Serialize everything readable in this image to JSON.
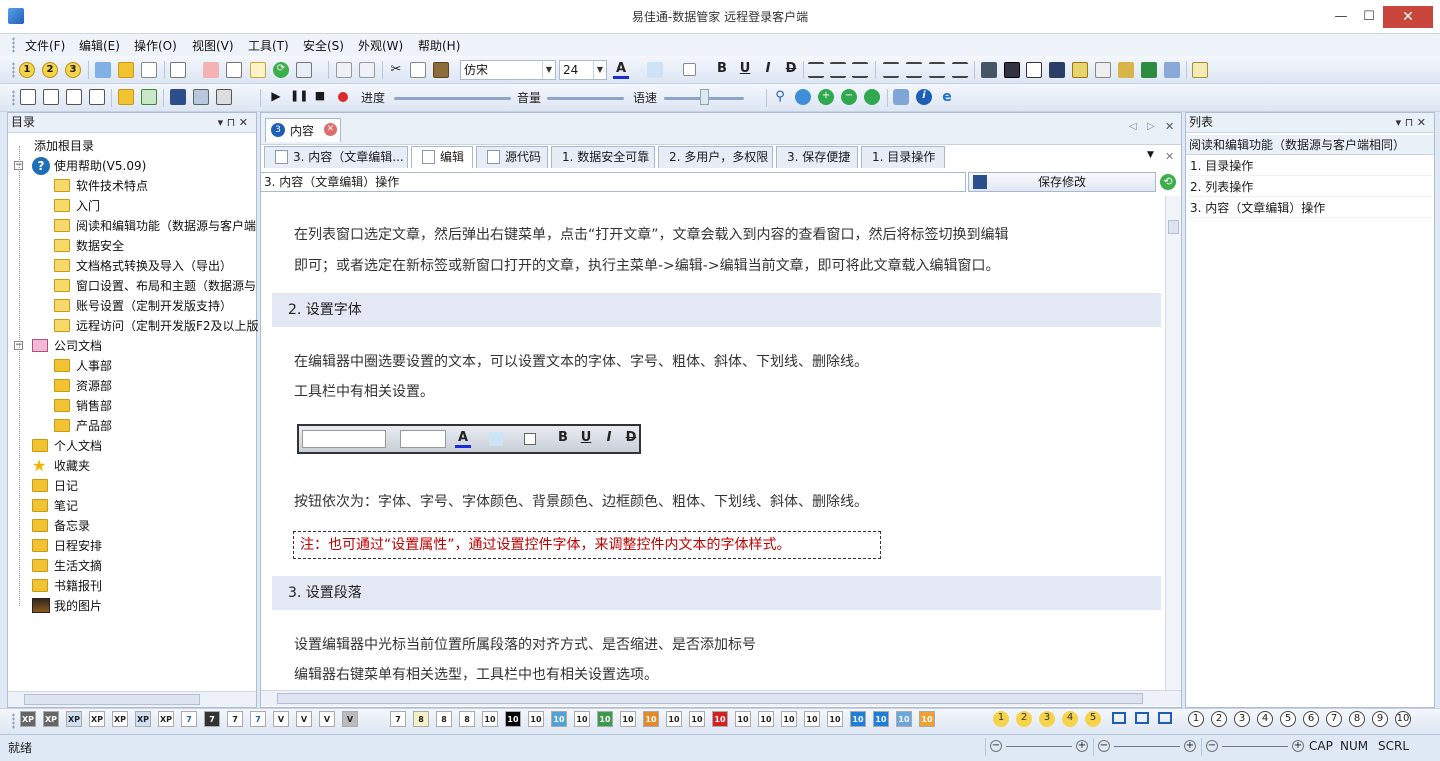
{
  "window": {
    "title": "易佳通-数据管家 远程登录客户端",
    "minimize": "—",
    "maximize": "☐",
    "close": "✕"
  },
  "menu": [
    "文件(F)",
    "编辑(E)",
    "操作(O)",
    "视图(V)",
    "工具(T)",
    "安全(S)",
    "外观(W)",
    "帮助(H)"
  ],
  "toolbar1": {
    "num_buttons": [
      "1",
      "2",
      "3"
    ],
    "font_family": "仿宋",
    "font_size": "24",
    "format_buttons": [
      "B",
      "U",
      "I",
      "D"
    ]
  },
  "toolbar2": {
    "progress_label": "进度",
    "volume_label": "音量",
    "speed_label": "语速",
    "progress": 0,
    "volume": 0.5,
    "speed": 0.5
  },
  "left_pane": {
    "title": "目录",
    "pin": "▾  ⊓  ✕",
    "tree": [
      {
        "label": "添加根目录",
        "level": 0,
        "icon": "none"
      },
      {
        "label": "使用帮助(V5.09)",
        "level": 0,
        "icon": "help-icon",
        "expanded": true
      },
      {
        "label": "软件技术特点",
        "level": 1,
        "icon": "doc-folder-icon"
      },
      {
        "label": "入门",
        "level": 1,
        "icon": "doc-folder-icon"
      },
      {
        "label": "阅读和编辑功能（数据源与客户端",
        "level": 1,
        "icon": "doc-folder-icon"
      },
      {
        "label": "数据安全",
        "level": 1,
        "icon": "doc-folder-icon"
      },
      {
        "label": "文档格式转换及导入（导出）",
        "level": 1,
        "icon": "doc-folder-icon"
      },
      {
        "label": "窗口设置、布局和主题（数据源与",
        "level": 1,
        "icon": "doc-folder-icon"
      },
      {
        "label": "账号设置（定制开发版支持）",
        "level": 1,
        "icon": "doc-folder-icon"
      },
      {
        "label": "远程访问（定制开发版F2及以上版",
        "level": 1,
        "icon": "doc-folder-icon"
      },
      {
        "label": "公司文档",
        "level": 0,
        "icon": "book-icon",
        "expanded": true
      },
      {
        "label": "人事部",
        "level": 1,
        "icon": "folder-icon"
      },
      {
        "label": "资源部",
        "level": 1,
        "icon": "folder-icon"
      },
      {
        "label": "销售部",
        "level": 1,
        "icon": "folder-icon"
      },
      {
        "label": "产品部",
        "level": 1,
        "icon": "folder-icon"
      },
      {
        "label": "个人文档",
        "level": 0,
        "icon": "folder-icon"
      },
      {
        "label": "收藏夹",
        "level": 0,
        "icon": "star-icon"
      },
      {
        "label": "日记",
        "level": 0,
        "icon": "folder-icon"
      },
      {
        "label": "笔记",
        "level": 0,
        "icon": "folder-icon"
      },
      {
        "label": "备忘录",
        "level": 0,
        "icon": "folder-icon"
      },
      {
        "label": "日程安排",
        "level": 0,
        "icon": "folder-icon"
      },
      {
        "label": "生活文摘",
        "level": 0,
        "icon": "folder-icon"
      },
      {
        "label": "书籍报刊",
        "level": 0,
        "icon": "folder-icon"
      },
      {
        "label": "我的图片",
        "level": 0,
        "icon": "picture-icon"
      }
    ]
  },
  "content": {
    "doc_tab": "内容",
    "doc_tab_badge": "3",
    "subtabs": [
      "3. 内容（文章编辑...",
      "编辑",
      "源代码",
      "1. 数据安全可靠",
      "2. 多用户，多权限",
      "3. 保存便捷",
      "1. 目录操作"
    ],
    "title_value": "3. 内容（文章编辑）操作",
    "save_label": "保存修改",
    "p1": "在列表窗口选定文章，然后弹出右键菜单，点击“打开文章”，文章会载入到内容的查看窗口，然后将标签切换到编辑",
    "p2": "即可；或者选定在新标签或新窗口打开的文章，执行主菜单->编辑->编辑当前文章，即可将此文章载入编辑窗口。",
    "s2": "2.  设置字体",
    "p3": "在编辑器中圈选要设置的文本，可以设置文本的字体、字号、粗体、斜体、下划线、删除线。",
    "p4": "工具栏中有相关设置。",
    "p5": "按钮依次为：字体、字号、字体颜色、背景颜色、边框颜色、粗体、下划线、斜体、删除线。",
    "note": "注：也可通过“设置属性”，通过设置控件字体，来调整控件内文本的字体样式。",
    "s3": "3.  设置段落",
    "p6": "设置编辑器中光标当前位置所属段落的对齐方式、是否缩进、是否添加标号",
    "p7": "编辑器右键菜单有相关选型，工具栏中也有相关设置选项。"
  },
  "right_pane": {
    "title": "列表",
    "header": "阅读和编辑功能（数据源与客户端相同）",
    "items": [
      "1.  目录操作",
      "2.  列表操作",
      "3.  内容（文章编辑）操作"
    ]
  },
  "bottom_toolbar": {
    "style_buttons": [
      "XP",
      "XP",
      "XP",
      "XP",
      "XP",
      "XP",
      "XP",
      "7",
      "7",
      "7",
      "7",
      "V",
      "V",
      "V",
      "V"
    ],
    "size_buttons": [
      "7",
      "8",
      "8",
      "8",
      "10",
      "10",
      "10",
      "10",
      "10",
      "10",
      "10",
      "10",
      "10",
      "10",
      "10",
      "10",
      "10",
      "10",
      "10",
      "10",
      "10",
      "10",
      "10",
      "10"
    ],
    "yellow_nums": [
      "1",
      "2",
      "3",
      "4",
      "5"
    ],
    "circle_nums": [
      "1",
      "2",
      "3",
      "4",
      "5",
      "6",
      "7",
      "8",
      "9",
      "10"
    ]
  },
  "status": {
    "ready": "就绪",
    "cap": "CAP",
    "num": "NUM",
    "scrl": "SCRL"
  },
  "colors": {
    "accent": "#1d5fb8",
    "close_red": "#c9463d",
    "note_red": "#c00000",
    "section_bg": "#e4e7f4"
  }
}
